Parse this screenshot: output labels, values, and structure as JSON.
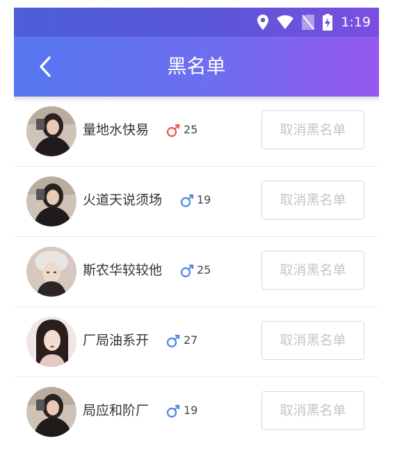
{
  "status": {
    "time": "1:19"
  },
  "header": {
    "title": "黑名单"
  },
  "colors": {
    "female": "#f0524a",
    "male": "#4b88e4",
    "header_start": "#5577f0",
    "header_end": "#9659ef"
  },
  "users": [
    {
      "name": "量地水快易",
      "gender": "female",
      "age": "25",
      "avatar": "woman-dark-top",
      "action": "取消黑名单"
    },
    {
      "name": "火道天说须场",
      "gender": "male",
      "age": "19",
      "avatar": "woman-dark-top",
      "action": "取消黑名单"
    },
    {
      "name": "斯农华较较他",
      "gender": "male",
      "age": "25",
      "avatar": "woman-white-hat",
      "action": "取消黑名单"
    },
    {
      "name": "厂局油系开",
      "gender": "male",
      "age": "27",
      "avatar": "woman-long-hair",
      "action": "取消黑名单"
    },
    {
      "name": "局应和阶厂",
      "gender": "male",
      "age": "19",
      "avatar": "woman-dark-top",
      "action": "取消黑名单"
    }
  ]
}
